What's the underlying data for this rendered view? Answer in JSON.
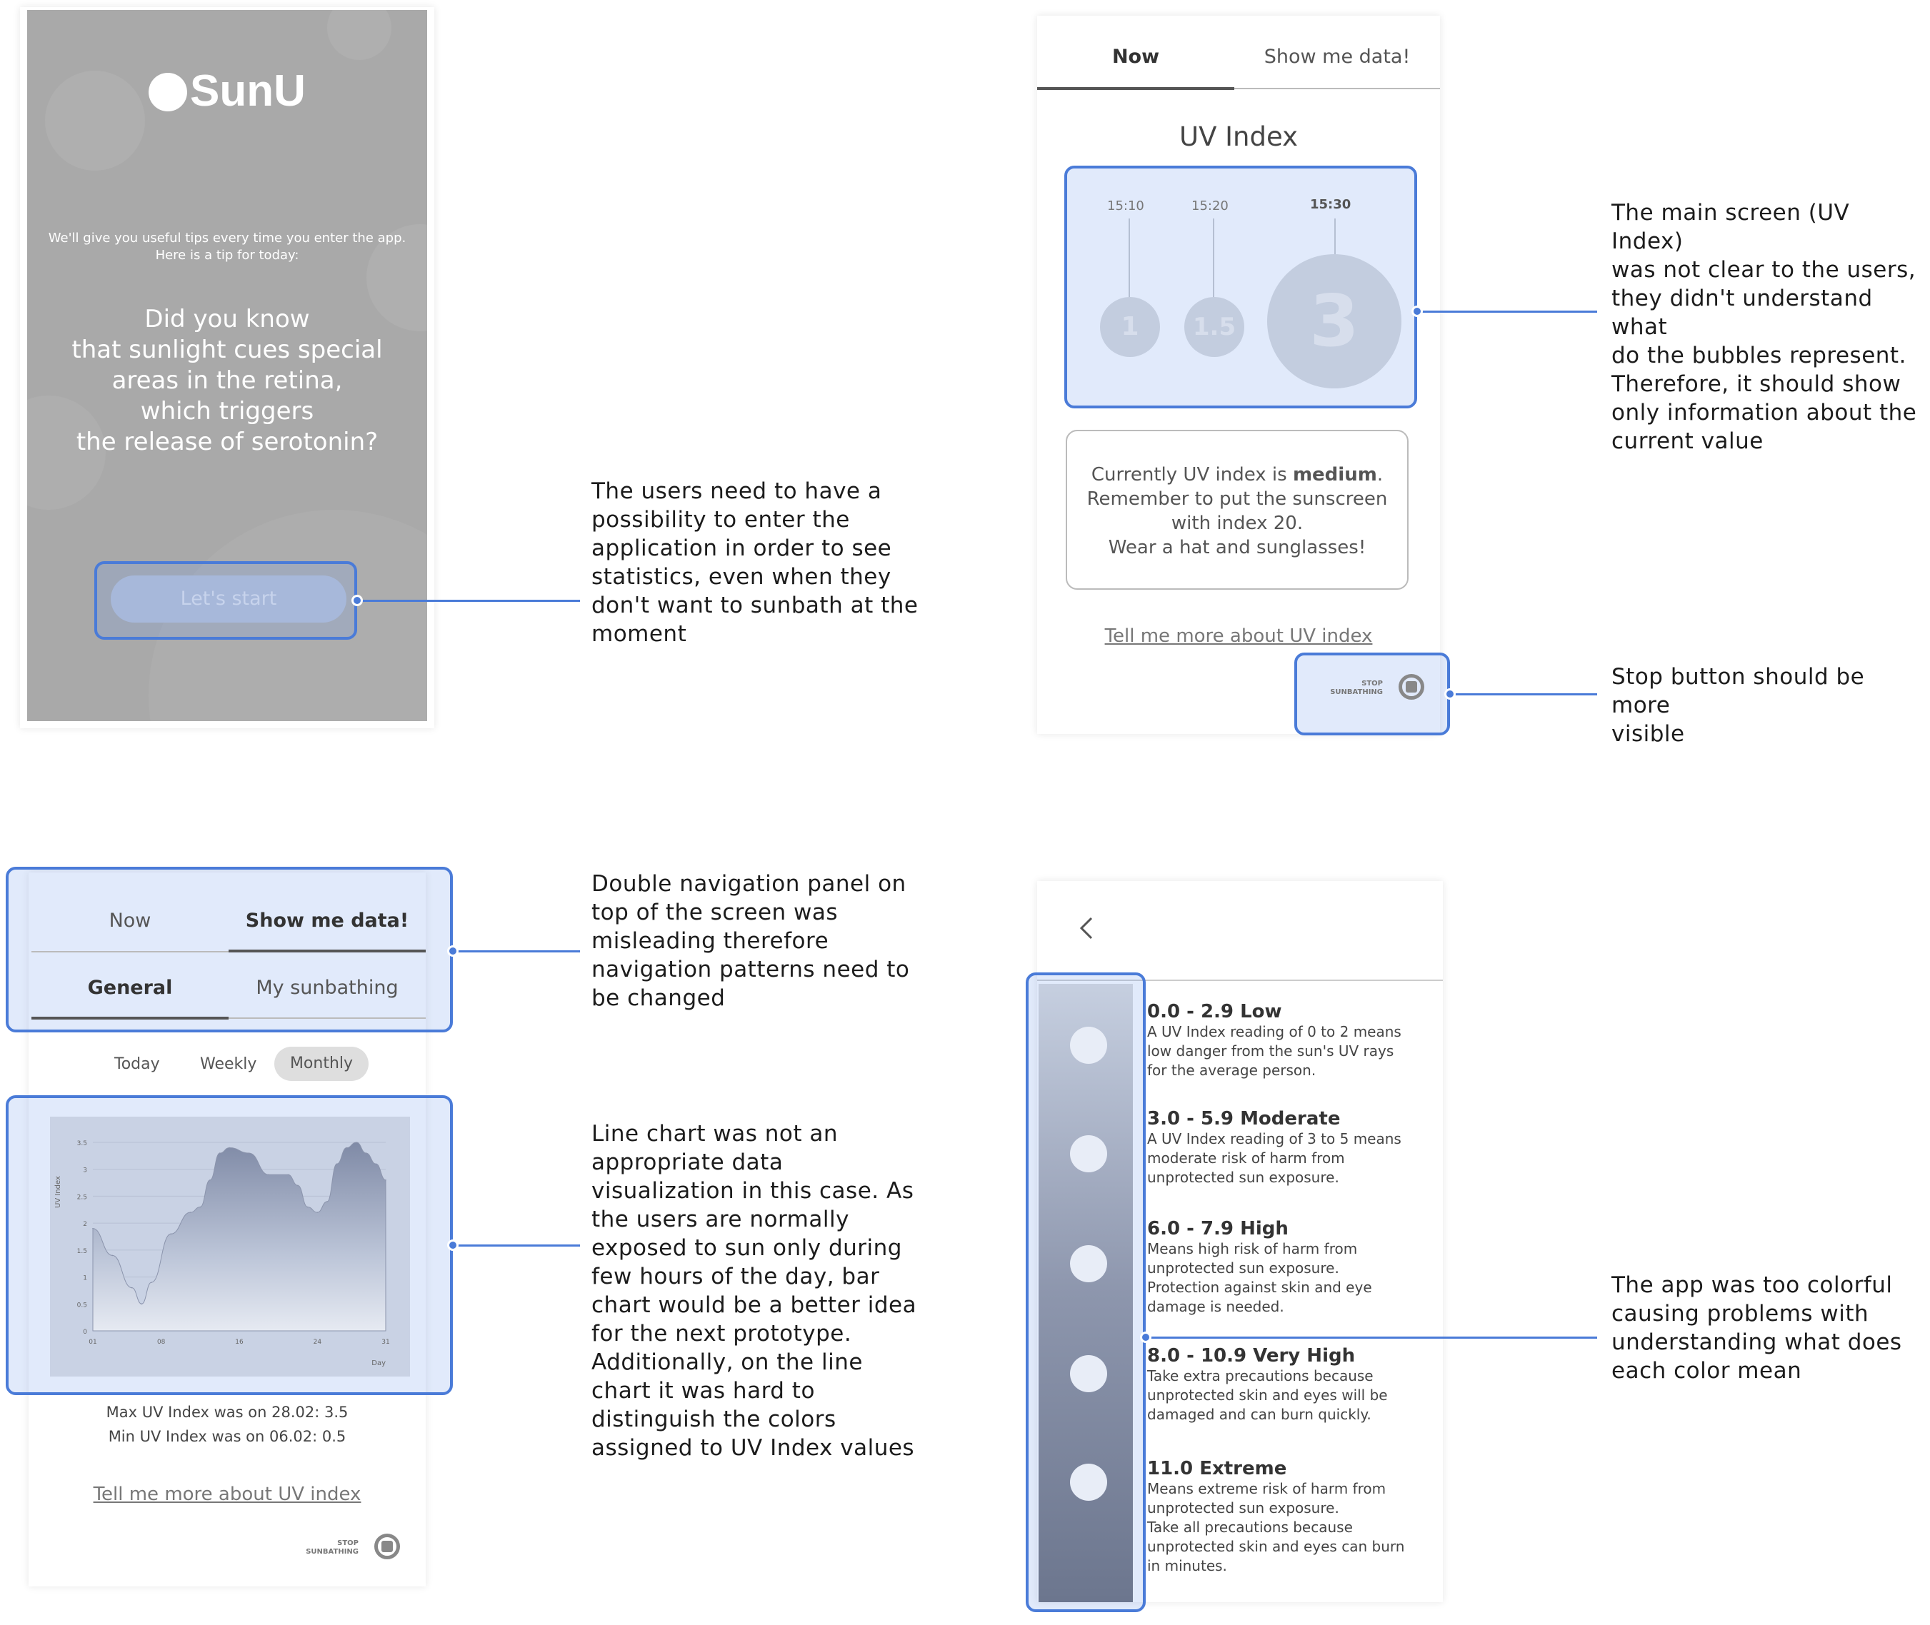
{
  "splash": {
    "logo": "SunU",
    "intro": "We'll give you useful tips every time you enter the app.\nHere is a tip for today:",
    "tip_lines": [
      "Did you know",
      "that sunlight cues special",
      "areas in the retina,",
      "which triggers",
      "the release of serotonin?"
    ],
    "start_button": "Let's start"
  },
  "uv_screen": {
    "tabs": [
      "Now",
      "Show me data!"
    ],
    "title": "UV Index",
    "bubbles": [
      {
        "time": "15:10",
        "value": "1"
      },
      {
        "time": "15:20",
        "value": "1.5"
      },
      {
        "time": "15:30",
        "value": "3"
      }
    ],
    "info_prefix": "Currently UV index is ",
    "info_level": "medium",
    "info_suffix": ".",
    "info_line2": "Remember to put the sunscreen",
    "info_line3": "with index 20.",
    "info_line4": "Wear a hat and sunglasses!",
    "more_link": "Tell me more about UV index",
    "stop_label_1": "STOP",
    "stop_label_2": "SUNBATHING"
  },
  "data_screen": {
    "top_tabs": [
      "Now",
      "Show me data!"
    ],
    "sub_tabs": [
      "General",
      "My sunbathing"
    ],
    "period_tabs": [
      "Today",
      "Weekly",
      "Monthly"
    ],
    "chart_ylabel": "UV Index",
    "chart_xlabel": "Day",
    "max_text": "Max UV Index was on 28.02: 3.5",
    "min_text": "Min UV Index was on 06.02: 0.5",
    "more_link": "Tell me more about UV index",
    "stop_label_1": "STOP",
    "stop_label_2": "SUNBATHING"
  },
  "chart_data": {
    "type": "area",
    "xlabel": "Day",
    "ylabel": "UV Index",
    "x_ticks": [
      "01",
      "08",
      "16",
      "24",
      "31"
    ],
    "y_ticks": [
      "0",
      "0.5",
      "1",
      "1.5",
      "2",
      "2.5",
      "3",
      "3.5"
    ],
    "ylim": [
      0,
      3.5
    ],
    "xlim": [
      1,
      31
    ],
    "x": [
      1,
      3,
      5,
      6,
      7,
      9,
      11,
      12,
      13,
      14,
      15,
      17,
      19,
      21,
      22,
      23,
      24,
      25,
      26,
      27,
      28,
      29,
      30,
      31
    ],
    "values": [
      1.9,
      1.4,
      0.8,
      0.5,
      0.9,
      1.8,
      2.2,
      2.3,
      2.8,
      3.3,
      3.4,
      3.3,
      2.9,
      2.9,
      2.7,
      2.3,
      2.2,
      2.4,
      3.1,
      3.4,
      3.5,
      3.3,
      3.1,
      2.8
    ]
  },
  "scale_screen": {
    "back_icon": "chevron-left-icon",
    "items": [
      {
        "title": "0.0 - 2.9 Low",
        "desc": "A UV Index reading of 0 to 2 means\nlow danger from the sun's UV rays\nfor the average person."
      },
      {
        "title": "3.0 - 5.9 Moderate",
        "desc": "A UV Index reading of 3 to 5 means\nmoderate risk of harm from\nunprotected sun exposure."
      },
      {
        "title": "6.0 - 7.9 High",
        "desc": "Means high risk of harm from\nunprotected sun exposure.\nProtection against skin and eye\ndamage is needed."
      },
      {
        "title": "8.0 - 10.9 Very High",
        "desc": "Take extra precautions because\nunprotected skin and eyes will be\ndamaged and can burn quickly."
      },
      {
        "title": "11.0 Extreme",
        "desc": "Means extreme risk of harm from\nunprotected sun exposure.\nTake all precautions because\nunprotected skin and eyes can burn\nin minutes."
      }
    ]
  },
  "notes": {
    "start": "The users need to have a\npossibility to enter the\napplication in order to see\nstatistics, even when they\ndon't want to sunbath at the\nmoment",
    "main": "The main screen (UV Index)\nwas not clear to the users,\nthey didn't understand what\ndo the bubbles represent.\nTherefore, it should show\nonly information about the\ncurrent value",
    "stop": "Stop button should be more\nvisible",
    "nav": "Double navigation panel on\ntop of the screen was\nmisleading therefore\nnavigation patterns need to\nbe changed",
    "chart": "Line chart was not an\nappropriate data\nvisualization in this case.  As\nthe users are normally\nexposed to sun only during\nfew hours of the day, bar\nchart would be a better idea\nfor the next prototype.\nAdditionally, on the line\nchart it was hard to\ndistinguish the colors\nassigned to UV Index values",
    "colors": "The app was too colorful\ncausing problems with\nunderstanding what does\neach color mean"
  },
  "colors": {
    "accent": "#4a7bd8",
    "highlight_fill": "#dbe6fa",
    "splash_bg": "#a9a9a9"
  }
}
